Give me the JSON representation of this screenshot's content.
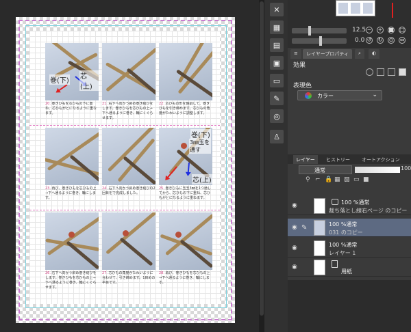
{
  "canvas": {
    "cells": [
      {
        "num": "20.",
        "text": "巻きひもを芯ひもの下に重ね、芯ひもがとになるように重なます。",
        "labels": [
          "巻(下)",
          "芯(上)"
        ]
      },
      {
        "num": "21.",
        "text": "右下へ向かう斜め巻き結びをします。巻きひもを芯ひもの上→下へ通るように巻き、輪にくぐらせます。",
        "labels": []
      },
      {
        "num": "22.",
        "text": "芯ひもの形を整調して、巻きひもを引き締めます。芯ひもの角度がたわいように調整します。",
        "labels": []
      },
      {
        "num": "23.",
        "text": "再び、巻きひもを芯ひもの上→下へ通るように巻き、輪にします。",
        "labels": []
      },
      {
        "num": "24.",
        "text": "右下へ向かう斜め巻き結びの2回目をで完成しました。",
        "labels": []
      },
      {
        "num": "25.",
        "text": "巻きひもに玉玉3㎜を1つ通してから、芯ひもの下に重ね、芯ひもがとになるように重ねます。",
        "labels": [
          "巻(下)",
          "3㎜玉を通す",
          "芯(上)"
        ]
      },
      {
        "num": "26.",
        "text": "右下へ向かう斜め巻き結びをします。巻きひもを芯ひもの上→下へ通るように巻き、輪にくぐらせます。",
        "labels": []
      },
      {
        "num": "27.",
        "text": "芯ひもの角度がたわいように合わせて、引き締めます。1目めの半目です。",
        "labels": []
      },
      {
        "num": "28.",
        "text": "再び、巻きひもを芯ひもの上→下へ通るように巻き、輪にします。",
        "labels": []
      }
    ]
  },
  "navigator": {
    "zoom": "12.5",
    "rotate": "0.0"
  },
  "panel_tabs": {
    "layer_property": "レイヤープロパティ"
  },
  "layer_property": {
    "effect_label": "効果",
    "expression_color_label": "表現色",
    "expression_color_value": "カラー"
  },
  "layer_tabs": [
    "レイヤー",
    "ヒストリー",
    "オートアクション"
  ],
  "layer_toolbar": {
    "blend_mode": "通常",
    "opacity": "100"
  },
  "layers": [
    {
      "mode": "100 %通常",
      "name": "裁ち落とし線右ページ のコピー",
      "selected": false,
      "thumb_icon": "folder-icon"
    },
    {
      "mode": "100 %通常",
      "name": "031 のコピー",
      "selected": true,
      "thumb_icon": "image-icon"
    },
    {
      "mode": "100 %通常",
      "name": "レイヤー 1",
      "selected": false,
      "thumb_icon": "none"
    },
    {
      "mode": "",
      "name": "用紙",
      "selected": false,
      "thumb_icon": "paper-icon"
    }
  ],
  "colors": {
    "accent": "#e02020",
    "secondary": "#2030e0",
    "bleed": "#c97ad0",
    "trim": "#7fd3e0",
    "selected_layer": "#5d6a82"
  }
}
